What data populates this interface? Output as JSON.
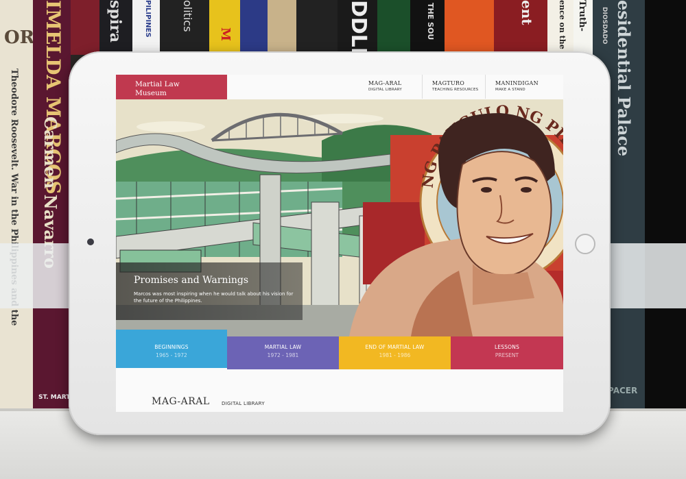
{
  "books": {
    "spine1": "OR",
    "imelda_marcos": "IMELDA MARCOS",
    "roosevelt": "Theodore Roosevelt. War in the Philippines and the",
    "carmen": "Carmen Navarro",
    "st_martins": "ST. MARTIN'S PRESS",
    "spira": "spira",
    "pilipinas": "PILIPINES",
    "politics": "olitics",
    "yellow": "M",
    "ddles": "DDLES",
    "the_sou": "THE SOU",
    "rent": "ent",
    "truth": "Truth-",
    "science": "ence on the L",
    "diosdado": "DIOSDADO",
    "palace": "esidential Palace",
    "pacer": "PACER"
  },
  "site": {
    "logo_line1": "Martial Law",
    "logo_line2": "Museum",
    "nav": [
      {
        "title": "MAG-ARAL",
        "sub": "DIGITAL LIBRARY"
      },
      {
        "title": "MAGTURO",
        "sub": "TEACHING RESOURCES"
      },
      {
        "title": "MANINDIGAN",
        "sub": "MAKE A STAND"
      }
    ],
    "hero": {
      "seal_text": "NG PANGULO NG PILIPINAS",
      "caption_title": "Promises and Warnings",
      "caption_body": "Marcos was most inspiring when he would talk about his vision for the future of the Philippines."
    },
    "eras": [
      {
        "label": "BEGINNINGS",
        "years": "1965 - 1972",
        "color": "#3aa6d9"
      },
      {
        "label": "MARTIAL LAW",
        "years": "1972 - 1981",
        "color": "#6c63b5"
      },
      {
        "label": "END OF MARTIAL LAW",
        "years": "1981 - 1986",
        "color": "#f2b822"
      },
      {
        "label": "LESSONS",
        "years": "PRESENT",
        "color": "#c33752"
      }
    ],
    "footer_title": "MAG-ARAL",
    "footer_sub": "DIGITAL LIBRARY"
  }
}
